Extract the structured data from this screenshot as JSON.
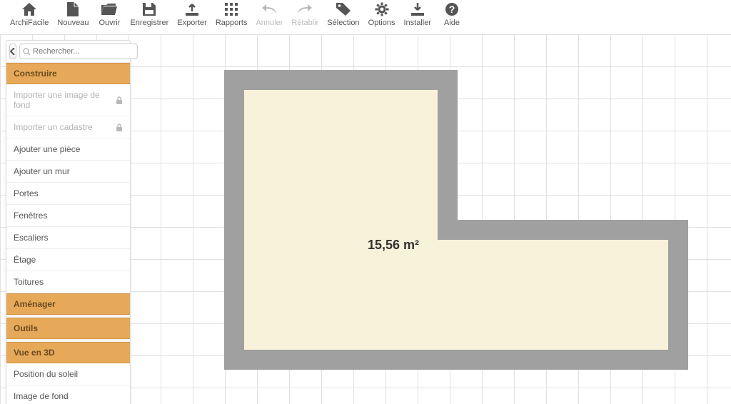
{
  "toolbar": [
    {
      "id": "home",
      "label": "ArchiFacile",
      "icon": "home",
      "enabled": true
    },
    {
      "id": "new",
      "label": "Nouveau",
      "icon": "file",
      "enabled": true
    },
    {
      "id": "open",
      "label": "Ouvrir",
      "icon": "folder",
      "enabled": true
    },
    {
      "id": "save",
      "label": "Enregistrer",
      "icon": "save",
      "enabled": true
    },
    {
      "id": "export",
      "label": "Exporter",
      "icon": "export",
      "enabled": true
    },
    {
      "id": "reports",
      "label": "Rapports",
      "icon": "grid",
      "enabled": true
    },
    {
      "id": "undo",
      "label": "Annuler",
      "icon": "undo",
      "enabled": false
    },
    {
      "id": "redo",
      "label": "Rétablir",
      "icon": "redo",
      "enabled": false
    },
    {
      "id": "select",
      "label": "Sélection",
      "icon": "tag",
      "enabled": true
    },
    {
      "id": "options",
      "label": "Options",
      "icon": "gear",
      "enabled": true
    },
    {
      "id": "install",
      "label": "Installer",
      "icon": "download",
      "enabled": true
    },
    {
      "id": "help",
      "label": "Aide",
      "icon": "help",
      "enabled": true
    }
  ],
  "search": {
    "placeholder": "Rechercher..."
  },
  "panel": {
    "sections": [
      {
        "title": "Construire",
        "items": [
          {
            "label": "Importer une image de fond",
            "locked": true
          },
          {
            "label": "Importer un cadastre",
            "locked": true
          },
          {
            "label": "Ajouter une pièce",
            "locked": false
          },
          {
            "label": "Ajouter un mur",
            "locked": false
          },
          {
            "label": "Portes",
            "locked": false
          },
          {
            "label": "Fenêtres",
            "locked": false
          },
          {
            "label": "Escaliers",
            "locked": false
          },
          {
            "label": "Étage",
            "locked": false
          },
          {
            "label": "Toitures",
            "locked": false
          }
        ]
      },
      {
        "title": "Aménager",
        "items": []
      },
      {
        "title": "Outils",
        "items": []
      },
      {
        "title": "Vue en 3D",
        "items": [
          {
            "label": "Position du soleil",
            "locked": false
          },
          {
            "label": "Image de fond",
            "locked": false
          }
        ]
      }
    ]
  },
  "plan": {
    "area_label": "15,56 m²"
  }
}
